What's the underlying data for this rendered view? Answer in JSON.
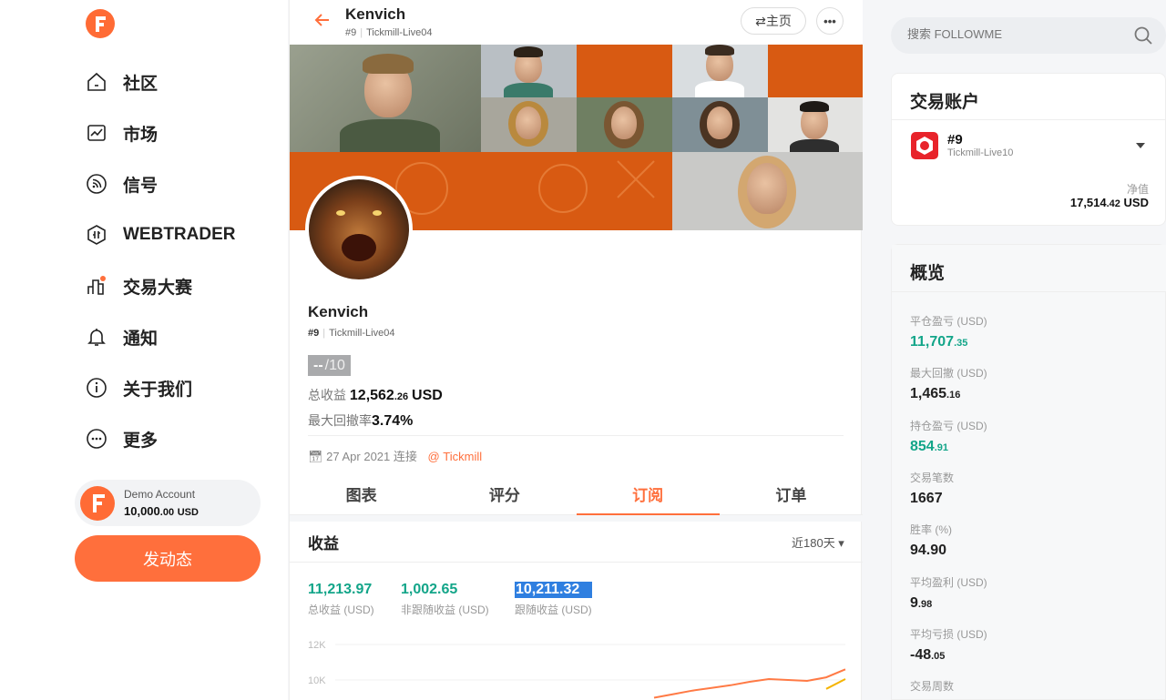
{
  "sidebar": {
    "nav": [
      {
        "label": "社区",
        "icon": "home-icon"
      },
      {
        "label": "市场",
        "icon": "chart-icon"
      },
      {
        "label": "信号",
        "icon": "signal-icon"
      },
      {
        "label": "WEBTRADER",
        "icon": "webtrader-icon"
      },
      {
        "label": "交易大赛",
        "icon": "contest-icon"
      },
      {
        "label": "通知",
        "icon": "bell-icon"
      },
      {
        "label": "关于我们",
        "icon": "info-icon"
      },
      {
        "label": "更多",
        "icon": "more-icon"
      }
    ],
    "demo": {
      "name": "Demo Account",
      "balance_main": "10,000",
      "balance_dec": ".00",
      "currency": "USD"
    },
    "post_button": "发动态"
  },
  "header": {
    "name": "Kenvich",
    "rank": "#9",
    "server": "Tickmill-Live04",
    "home_button": "⇄主页",
    "more_button": "•••"
  },
  "profile": {
    "name": "Kenvich",
    "rank": "#9",
    "server": "Tickmill-Live04",
    "score_value": "--",
    "score_max": "/10",
    "total_profit_label": "总收益",
    "total_profit_main": "12,562",
    "total_profit_dec": ".26",
    "total_profit_unit": "USD",
    "max_dd_label": "最大回撤率",
    "max_dd_value": "3.74%",
    "joined_date": "27 Apr 2021 连接",
    "broker": "@ Tickmill"
  },
  "tabs": [
    {
      "label": "图表",
      "active": false
    },
    {
      "label": "评分",
      "active": false
    },
    {
      "label": "订阅",
      "active": true
    },
    {
      "label": "订单",
      "active": false
    }
  ],
  "earnings": {
    "title": "收益",
    "period": "近180天 ▾",
    "kpis": [
      {
        "value": "11,213.97",
        "label": "总收益 (USD)"
      },
      {
        "value": "1,002.65",
        "label": "非跟随收益 (USD)"
      },
      {
        "value": "10,211.32",
        "label": "跟随收益 (USD)",
        "selected": true
      }
    ]
  },
  "chart_data": {
    "type": "line",
    "title": "",
    "xlabel": "",
    "ylabel": "",
    "y_ticks": [
      "12K",
      "10K"
    ],
    "ylim": [
      9500,
      12500
    ],
    "series": [
      {
        "color": "#ff7a45",
        "x": [
          0,
          1,
          2,
          3,
          4,
          5,
          6,
          7,
          8,
          9,
          10
        ],
        "values": [
          9000,
          9200,
          9400,
          9550,
          9700,
          9900,
          10050,
          10000,
          9950,
          10150,
          10600
        ]
      },
      {
        "color": "#f5b400",
        "x": [
          9,
          10
        ],
        "values": [
          9500,
          10050
        ]
      }
    ]
  },
  "search": {
    "placeholder": "搜索 FOLLOWME"
  },
  "account": {
    "title": "交易账户",
    "rank": "#9",
    "server": "Tickmill-Live10",
    "nv_label": "净值",
    "nv_main": "17,514",
    "nv_dec": ".42",
    "nv_unit": "USD"
  },
  "overview": {
    "title": "概览",
    "items": [
      {
        "label": "平仓盈亏 (USD)",
        "main": "11,707",
        "dec": ".35",
        "green": true
      },
      {
        "label": "最大回撤 (USD)",
        "main": "1,465",
        "dec": ".16",
        "green": false
      },
      {
        "label": "持仓盈亏 (USD)",
        "main": "854",
        "dec": ".91",
        "green": true
      },
      {
        "label": "交易笔数",
        "main": "1667",
        "dec": "",
        "green": false
      },
      {
        "label": "胜率 (%)",
        "main": "94.90",
        "dec": "",
        "green": false
      },
      {
        "label": "平均盈利 (USD)",
        "main": "9",
        "dec": ".98",
        "green": false
      },
      {
        "label": "平均亏损 (USD)",
        "main": "-48",
        "dec": ".05",
        "green": false
      },
      {
        "label": "交易周数",
        "main": "",
        "dec": "",
        "green": false
      }
    ]
  },
  "colors": {
    "accent": "#ff6f3c",
    "green": "#13a589",
    "selection": "#2f7fe0"
  }
}
